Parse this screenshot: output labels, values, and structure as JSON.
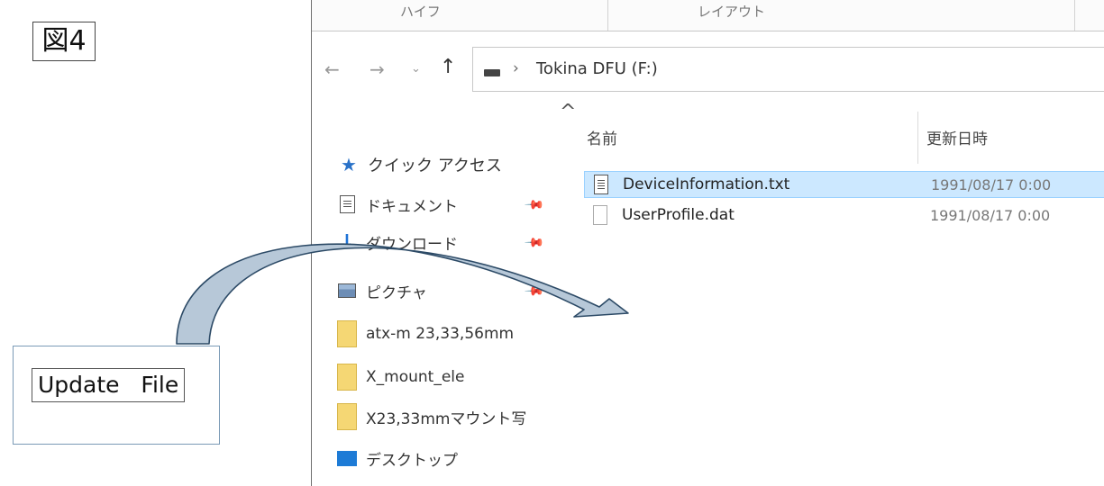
{
  "figure": {
    "label": "図4"
  },
  "callout": {
    "label": "Update   File"
  },
  "explorer": {
    "ribbon_tabs": [
      "ハイフ",
      "レイアウト"
    ],
    "address": {
      "path": "Tokina DFU (F:)"
    },
    "nav_pane": {
      "quick_access": "クイック アクセス",
      "items": [
        {
          "label": "ドキュメント",
          "icon": "document-icon",
          "pinned": true
        },
        {
          "label": "ダウンロード",
          "icon": "download-icon",
          "pinned": true
        },
        {
          "label": "ピクチャ",
          "icon": "picture-icon",
          "pinned": true
        },
        {
          "label": "atx-m 23,33,56mm",
          "icon": "folder-icon",
          "pinned": false
        },
        {
          "label": "X_mount_ele",
          "icon": "folder-icon",
          "pinned": false
        },
        {
          "label": "X23,33mmマウント写",
          "icon": "folder-icon",
          "pinned": false
        },
        {
          "label": "デスクトップ",
          "icon": "desktop-icon",
          "pinned": false
        }
      ]
    },
    "columns": {
      "name": "名前",
      "modified": "更新日時"
    },
    "files": [
      {
        "name": "DeviceInformation.txt",
        "date": "1991/08/17 0:00",
        "icon": "text-file-icon",
        "selected": true
      },
      {
        "name": "UserProfile.dat",
        "date": "1991/08/17 0:00",
        "icon": "data-file-icon",
        "selected": false
      }
    ]
  },
  "colors": {
    "selection_bg": "#cce8ff",
    "arrow_fill": "#b7c8d8",
    "arrow_stroke": "#2c4a66",
    "quick_access_star": "#2a72c8"
  }
}
